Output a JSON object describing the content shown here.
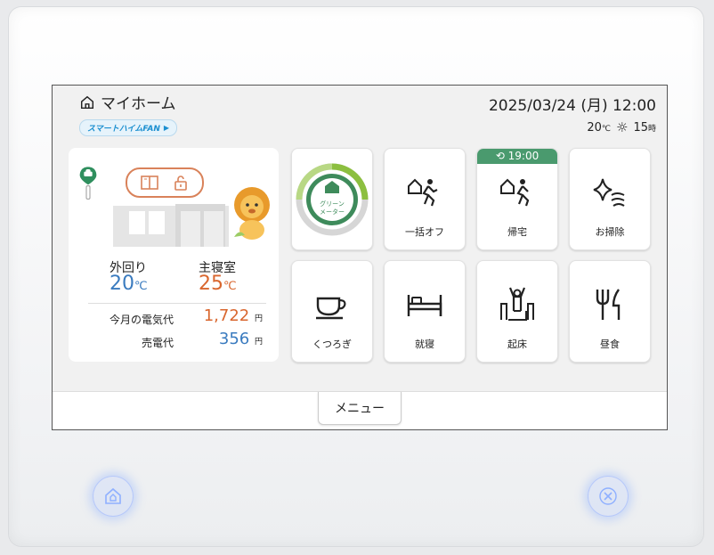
{
  "header": {
    "home_label": "マイホーム",
    "badge": "スマートハイムFAN",
    "datetime": "2025/03/24 (月) 12:00",
    "temperature": "20",
    "temp_unit": "℃",
    "forecast_hour": "15",
    "forecast_unit": "時"
  },
  "status": {
    "outside_label": "外回り",
    "outside_temp": "20",
    "bedroom_label": "主寝室",
    "bedroom_temp": "25",
    "temp_unit": "℃",
    "electricity_label": "今月の電気代",
    "electricity_value": "1,722",
    "sold_label": "売電代",
    "sold_value": "356",
    "currency": "円"
  },
  "tiles": {
    "green_meter": "グリーンメーター",
    "all_off": "一括オフ",
    "return_home": "帰宅",
    "return_timer": "19:00",
    "cleaning": "お掃除",
    "relax": "くつろぎ",
    "sleep": "就寝",
    "wake": "起床",
    "lunch": "昼食"
  },
  "menu": {
    "label": "メニュー"
  },
  "colors": {
    "accent_blue": "#3a7bbf",
    "accent_orange": "#d9662e",
    "timer_green": "#4a9a6e"
  }
}
